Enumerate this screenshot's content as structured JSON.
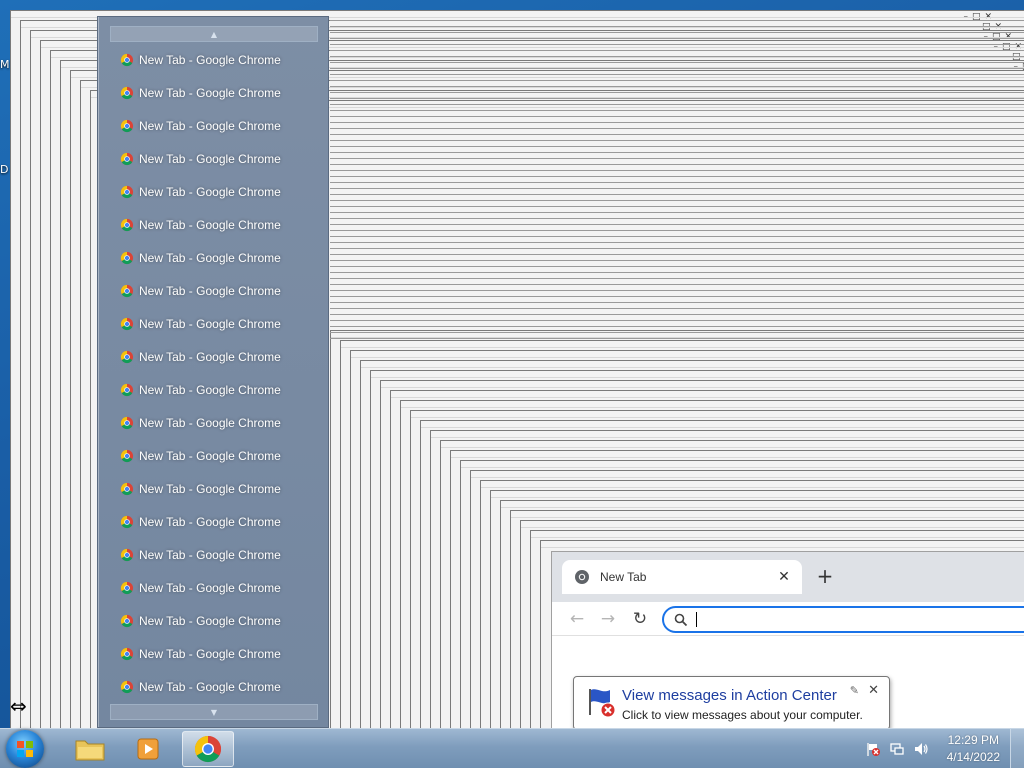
{
  "desktop": {
    "edge_icon_letters": [
      "M",
      "D"
    ]
  },
  "stacked_window_controls": [
    "–",
    "□",
    "✕"
  ],
  "jump_list": {
    "scroll_up": "▲",
    "scroll_down": "▼",
    "items": [
      {
        "label": "New Tab - Google Chrome"
      },
      {
        "label": "New Tab - Google Chrome"
      },
      {
        "label": "New Tab - Google Chrome"
      },
      {
        "label": "New Tab - Google Chrome"
      },
      {
        "label": "New Tab - Google Chrome"
      },
      {
        "label": "New Tab - Google Chrome"
      },
      {
        "label": "New Tab - Google Chrome"
      },
      {
        "label": "New Tab - Google Chrome"
      },
      {
        "label": "New Tab - Google Chrome"
      },
      {
        "label": "New Tab - Google Chrome"
      },
      {
        "label": "New Tab - Google Chrome"
      },
      {
        "label": "New Tab - Google Chrome"
      },
      {
        "label": "New Tab - Google Chrome"
      },
      {
        "label": "New Tab - Google Chrome"
      },
      {
        "label": "New Tab - Google Chrome"
      },
      {
        "label": "New Tab - Google Chrome"
      },
      {
        "label": "New Tab - Google Chrome"
      },
      {
        "label": "New Tab - Google Chrome"
      },
      {
        "label": "New Tab - Google Chrome"
      },
      {
        "label": "New Tab - Google Chrome"
      }
    ]
  },
  "chrome": {
    "tab_title": "New Tab",
    "tab_close": "✕",
    "new_tab": "+",
    "back": "←",
    "forward": "→",
    "reload": "↻",
    "omnibox_value": ""
  },
  "balloon": {
    "title": "View messages in Action Center",
    "text": "Click to view messages about your computer.",
    "close": "✕",
    "pin": "✎"
  },
  "taskbar": {
    "pinned": [
      "start-orb",
      "explorer-icon",
      "media-player-icon",
      "chrome-icon"
    ],
    "active_app": "chrome-icon"
  },
  "clock": {
    "time": "12:29 PM",
    "date": "4/14/2022"
  },
  "colors": {
    "jump_list_bg": "#7a8ca3",
    "omnibox_focus": "#1a73e8",
    "balloon_title": "#1e3ea0",
    "taskbar": "#8aa7c4"
  }
}
